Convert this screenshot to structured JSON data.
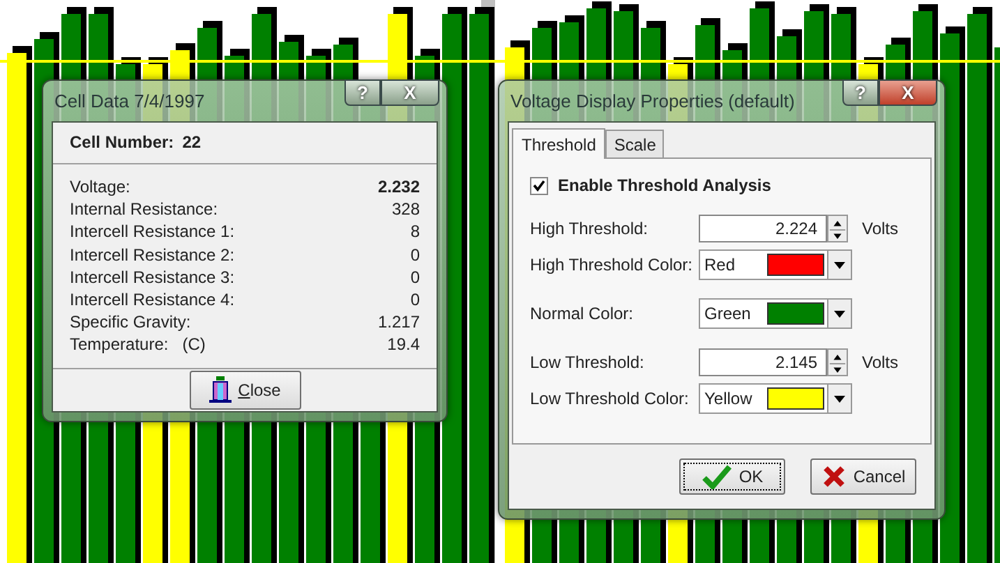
{
  "cell_data_window": {
    "title": "Cell Data 7/4/1997",
    "help_button": "?",
    "close_button": "X",
    "cell_number": {
      "label": "Cell Number:",
      "value": "22"
    },
    "rows": [
      {
        "label": "Voltage:",
        "value": "2.232",
        "emphasized": true
      },
      {
        "label": "Internal Resistance:",
        "value": "328",
        "emphasized": false
      },
      {
        "label": "Intercell Resistance 1:",
        "value": "8",
        "emphasized": false
      },
      {
        "label": "Intercell Resistance 2:",
        "value": "0",
        "emphasized": false
      },
      {
        "label": "Intercell Resistance 3:",
        "value": "0",
        "emphasized": false
      },
      {
        "label": "Intercell Resistance 4:",
        "value": "0",
        "emphasized": false
      },
      {
        "label": "Specific Gravity:",
        "value": "1.217",
        "emphasized": false
      },
      {
        "label": "Temperature:   (C)",
        "value": "19.4",
        "emphasized": false
      }
    ],
    "close": {
      "label": "Close"
    }
  },
  "properties_window": {
    "title": "Voltage Display Properties (default)",
    "help_button": "?",
    "close_button": "X",
    "tabs": [
      {
        "label": "Threshold",
        "selected": true
      },
      {
        "label": "Scale",
        "selected": false
      }
    ],
    "enable_checkbox": {
      "label": "Enable Threshold Analysis",
      "checked": true
    },
    "groups": [
      [
        {
          "kind": "spin",
          "label": "High Threshold:",
          "value": "2.224",
          "unit": "Volts"
        },
        {
          "kind": "color",
          "label": "High Threshold Color:",
          "value": "Red",
          "color": "#ff0000"
        }
      ],
      [
        {
          "kind": "color",
          "label": "Normal Color:",
          "value": "Green",
          "color": "#008000"
        }
      ],
      [
        {
          "kind": "spin",
          "label": "Low Threshold:",
          "value": "2.145",
          "unit": "Volts"
        },
        {
          "kind": "color",
          "label": "Low Threshold Color:",
          "value": "Yellow",
          "color": "#ffff00"
        }
      ]
    ],
    "buttons": [
      {
        "kind": "ok",
        "label": "OK",
        "focused": true
      },
      {
        "kind": "cancel",
        "label": "Cancel",
        "focused": false
      }
    ]
  }
}
